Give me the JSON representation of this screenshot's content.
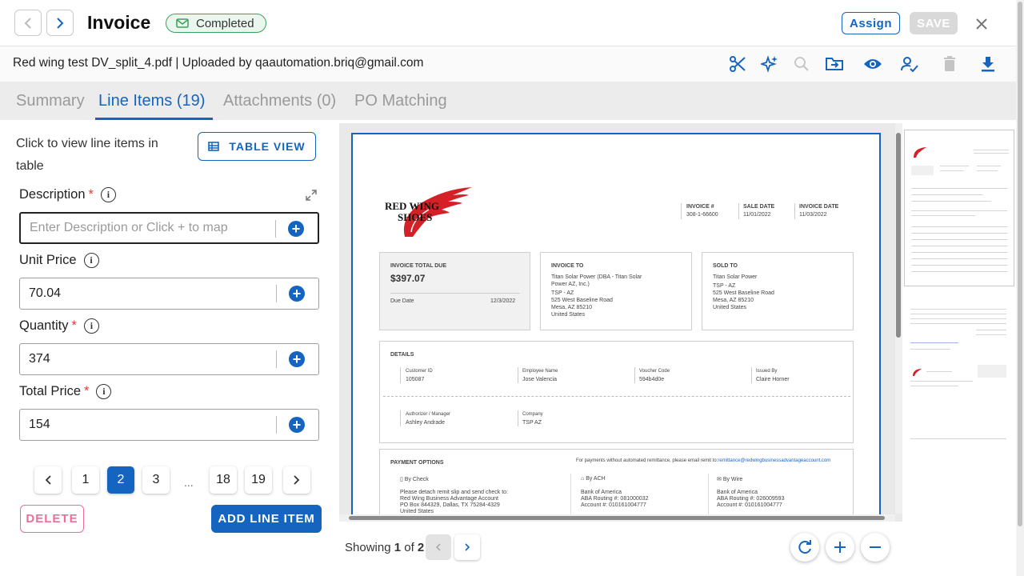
{
  "header": {
    "title": "Invoice",
    "status": "Completed",
    "assign_label": "Assign",
    "save_label": "SAVE"
  },
  "subheader": {
    "file_info": "Red wing test DV_split_4.pdf | Uploaded by qaautomation.briq@gmail.com",
    "toolbar_icons": [
      "scissors-icon",
      "sparkle-icon",
      "zoom-search-icon",
      "move-folder-icon",
      "eye-icon",
      "user-check-icon",
      "trash-icon",
      "download-icon"
    ]
  },
  "tabs": [
    {
      "label": "Summary"
    },
    {
      "label": "Line Items (19)"
    },
    {
      "label": "Attachments (0)"
    },
    {
      "label": "PO Matching"
    }
  ],
  "line_items": {
    "hint": "Click to view line items in table",
    "table_view_label": "TABLE VIEW",
    "fields": [
      {
        "label": "Description",
        "required": "*",
        "value": "",
        "placeholder": "Enter Description or Click + to map"
      },
      {
        "label": "Unit Price",
        "required": "",
        "value": "70.04"
      },
      {
        "label": "Quantity",
        "required": "*",
        "value": "374"
      },
      {
        "label": "Total Price",
        "required": "*",
        "value": "154"
      }
    ],
    "pagination": {
      "pages": [
        "1",
        "2",
        "3",
        "...",
        "18",
        "19"
      ],
      "current": "2"
    },
    "delete_label": "DELETE",
    "add_label": "ADD LINE ITEM"
  },
  "document": {
    "logo_line1": "RED WING",
    "logo_line2": "SHOES",
    "meta": [
      {
        "label": "INVOICE #",
        "value": "308-1-66600"
      },
      {
        "label": "SALE DATE",
        "value": "11/01/2022"
      },
      {
        "label": "INVOICE DATE",
        "value": "11/03/2022"
      }
    ],
    "total_due_label": "INVOICE TOTAL DUE",
    "total_due": "$397.07",
    "due_date_label": "Due Date",
    "due_date": "12/3/2022",
    "invoice_to_label": "INVOICE TO",
    "invoice_to": [
      "Titan Solar Power (DBA - Titan Solar",
      "Power AZ, Inc.)",
      "TSP - AZ",
      "525 West Baseline Road",
      "Mesa, AZ 85210",
      "United States"
    ],
    "sold_to_label": "SOLD TO",
    "sold_to": [
      "Titan Solar Power",
      "TSP - AZ",
      "525 West Baseline Road",
      "Mesa, AZ 85210",
      "United States"
    ],
    "details_label": "DETAILS",
    "details": [
      {
        "label": "Customer ID",
        "value": "105087"
      },
      {
        "label": "Employee Name",
        "value": "Jose Valencia"
      },
      {
        "label": "Voucher Code",
        "value": "594b4d0e"
      },
      {
        "label": "Issued By",
        "value": "Claire Horner"
      },
      {
        "label": "Authorizer / Manager",
        "value": "Ashley Andrade"
      },
      {
        "label": "Company",
        "value": "TSP AZ"
      }
    ],
    "payment_label": "PAYMENT OPTIONS",
    "payment_note": "For payments without automated remittance, please email remit to:",
    "payment_email": "remittance@redwingbusinessadvantageaccount.com",
    "by_check_label": "By Check",
    "by_check": [
      "Please detach remit slip and send check to:",
      "Red Wing Business Advantage Account",
      "PO Box 844329, Dallas, TX 75284-4329",
      "United States"
    ],
    "by_ach_label": "By ACH",
    "by_ach": [
      "Bank of America",
      "ABA Routing #: 081000032",
      "Account #: 010161004777"
    ],
    "by_wire_label": "By Wire",
    "by_wire": [
      "Bank of America",
      "ABA Routing #: 026009593",
      "Account #: 010161004777"
    ]
  },
  "viewer": {
    "showing_prefix": "Showing",
    "current_page": "1",
    "of_label": "of",
    "total_pages": "2"
  },
  "colors": {
    "accent": "#1565c0",
    "status_green": "#3aa05a",
    "delete_pink": "#f06b9a",
    "required_red": "#e53935"
  }
}
